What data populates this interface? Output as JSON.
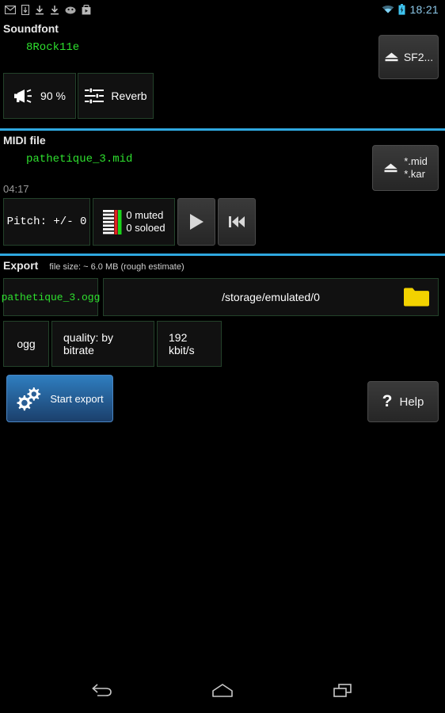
{
  "statusbar": {
    "time": "18:21",
    "icons": [
      "gmail-icon",
      "sdcard-icon",
      "download-icon",
      "download-icon",
      "app-icon",
      "play-store-icon"
    ],
    "right_icons": [
      "wifi-icon",
      "battery-charging-icon"
    ],
    "time_color": "#8cc7e8"
  },
  "soundfont": {
    "title": "Soundfont",
    "name": "8Rock11e",
    "name_color": "#2ee02e",
    "load_button": "SF2...",
    "volume_button": "90 %",
    "reverb_button": "Reverb"
  },
  "midi": {
    "title": "MIDI file",
    "name": "pathetique_3.mid",
    "load_button_line1": "*.mid",
    "load_button_line2": "*.kar",
    "duration": "04:17",
    "pitch_button": "Pitch: +/- 0",
    "muted_label": "0 muted",
    "soloed_label": "0 soloed"
  },
  "export": {
    "title": "Export",
    "filesize": "file size: ~ 6.0 MB (rough estimate)",
    "filename": "pathetique_3.ogg",
    "path": "/storage/emulated/0",
    "format": "ogg",
    "quality": "quality: by bitrate",
    "bitrate": "192 kbit/s",
    "start_button": "Start export",
    "help_button": "Help"
  },
  "navbar": {
    "back": "back-icon",
    "home": "home-icon",
    "recents": "recents-icon"
  },
  "colors": {
    "accent_divider": "#2fa8e0",
    "green_text": "#2ee02e",
    "green_border": "#23422a",
    "blue_button": "#2f7ec0",
    "folder_yellow": "#f2d200"
  }
}
